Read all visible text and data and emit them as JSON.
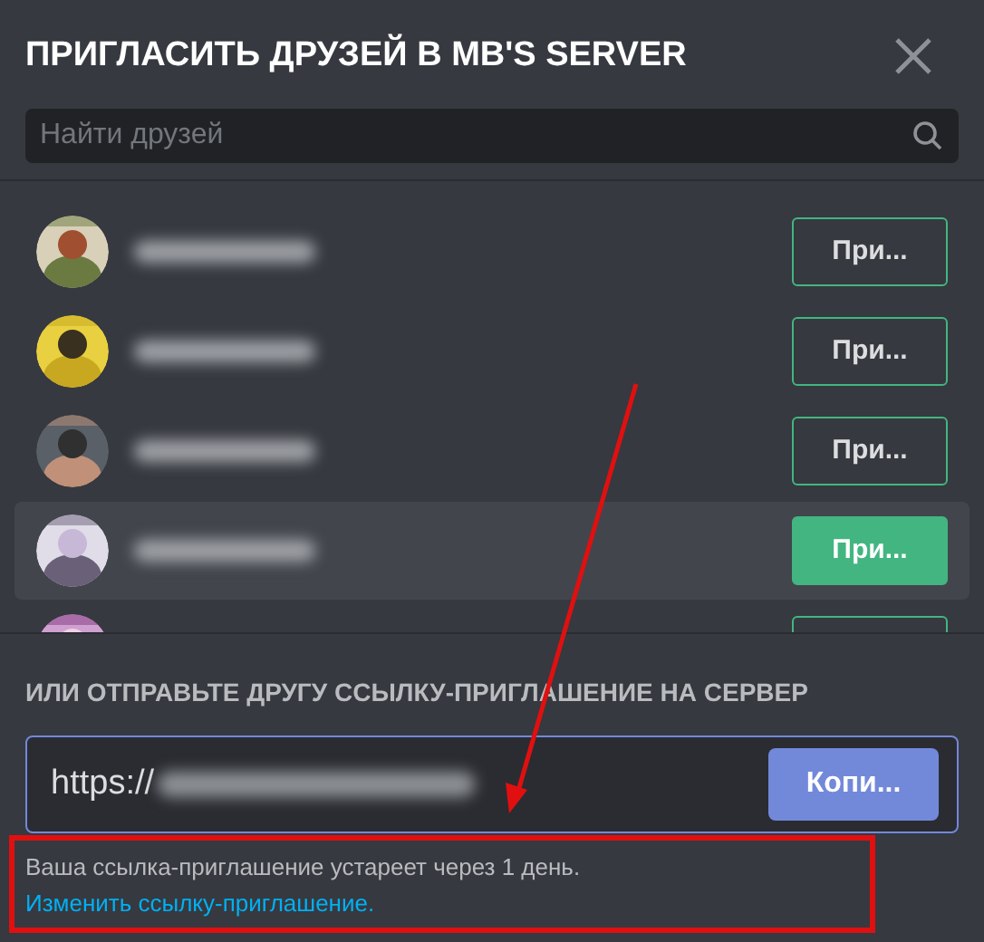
{
  "title": "ПРИГЛАСИТЬ ДРУЗЕЙ В MB'S SERVER",
  "search": {
    "placeholder": "Найти друзей"
  },
  "friends": [
    {
      "selected": false,
      "invite_label": "При..."
    },
    {
      "selected": false,
      "invite_label": "При..."
    },
    {
      "selected": false,
      "invite_label": "При..."
    },
    {
      "selected": true,
      "invite_label": "При..."
    },
    {
      "selected": false
    }
  ],
  "link_section": {
    "label": "ИЛИ ОТПРАВЬТЕ ДРУГУ ССЫЛКУ-ПРИГЛАШЕНИЕ НА СЕРВЕР",
    "url_start": "https://",
    "copy_label": "Копи...",
    "note": "Ваша ссылка-приглашение устареет через 1 день.",
    "note_link": "Изменить ссылку-приглашение."
  }
}
